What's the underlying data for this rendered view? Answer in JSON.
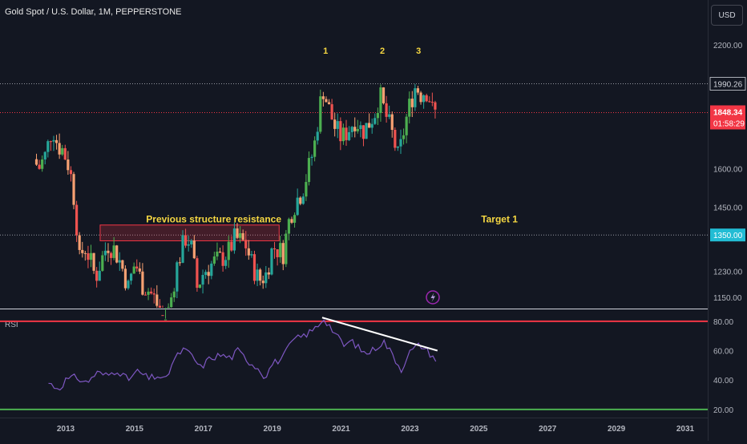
{
  "header": {
    "title": "Gold Spot / U.S. Dollar, 1M, PEPPERSTONE"
  },
  "price_scale": {
    "currency_button": "USD"
  },
  "colors": {
    "background": "#131722",
    "bull": "#26a69a",
    "bull_bright": "#4caf50",
    "bear": "#ef5350",
    "bear_soft": "#f7a072",
    "rsi_line": "#7e57c2",
    "overbought": "#f23645",
    "oversold": "#089981",
    "annotation": "#f5d742",
    "last_price_badge": "#f23645",
    "level_badge": "#22bcd4",
    "resistance_box": "#f2364555"
  },
  "chart_data": [
    {
      "type": "candlestick",
      "symbol": "Gold Spot / U.S. Dollar",
      "interval": "1M",
      "exchange": "PEPPERSTONE",
      "y_scale": "log",
      "ylim": [
        1120,
        2320
      ],
      "y_ticks": [
        2200.0,
        1600.0,
        1450.0,
        1230.0,
        1150.0
      ],
      "x_ticks": [
        "2013",
        "2015",
        "2017",
        "2019",
        "2021",
        "2023",
        "2025",
        "2027",
        "2029",
        "2031"
      ],
      "x_range_years": [
        2012.0,
        2032.0
      ],
      "last_price": {
        "value": "1848.34",
        "countdown": "01:58:29"
      },
      "level_labels": [
        {
          "value": "1990.26",
          "style": "plain"
        },
        {
          "value": "1350.00",
          "style": "badge"
        }
      ],
      "price_series_years": [
        2012.15,
        2023.75
      ],
      "price_anchors": [
        [
          2012.15,
          1640
        ],
        [
          2012.3,
          1600
        ],
        [
          2012.5,
          1660
        ],
        [
          2012.7,
          1780
        ],
        [
          2012.85,
          1700
        ],
        [
          2013.0,
          1680
        ],
        [
          2013.2,
          1600
        ],
        [
          2013.35,
          1460
        ],
        [
          2013.5,
          1240
        ],
        [
          2013.6,
          1320
        ],
        [
          2013.75,
          1280
        ],
        [
          2013.95,
          1210
        ],
        [
          2014.1,
          1260
        ],
        [
          2014.3,
          1320
        ],
        [
          2014.5,
          1300
        ],
        [
          2014.7,
          1250
        ],
        [
          2014.9,
          1180
        ],
        [
          2015.1,
          1260
        ],
        [
          2015.3,
          1190
        ],
        [
          2015.5,
          1170
        ],
        [
          2015.7,
          1140
        ],
        [
          2015.9,
          1070
        ],
        [
          2016.1,
          1120
        ],
        [
          2016.3,
          1240
        ],
        [
          2016.55,
          1340
        ],
        [
          2016.7,
          1330
        ],
        [
          2016.9,
          1180
        ],
        [
          2017.1,
          1230
        ],
        [
          2017.4,
          1260
        ],
        [
          2017.6,
          1270
        ],
        [
          2017.8,
          1290
        ],
        [
          2018.0,
          1340
        ],
        [
          2018.3,
          1320
        ],
        [
          2018.5,
          1250
        ],
        [
          2018.7,
          1200
        ],
        [
          2018.9,
          1220
        ],
        [
          2019.1,
          1310
        ],
        [
          2019.4,
          1290
        ],
        [
          2019.6,
          1420
        ],
        [
          2019.8,
          1480
        ],
        [
          2019.95,
          1510
        ],
        [
          2020.1,
          1580
        ],
        [
          2020.3,
          1690
        ],
        [
          2020.55,
          1970
        ],
        [
          2020.7,
          1880
        ],
        [
          2020.9,
          1780
        ],
        [
          2021.1,
          1730
        ],
        [
          2021.3,
          1770
        ],
        [
          2021.5,
          1820
        ],
        [
          2021.7,
          1760
        ],
        [
          2021.9,
          1800
        ],
        [
          2022.1,
          1860
        ],
        [
          2022.2,
          1940
        ],
        [
          2022.35,
          1850
        ],
        [
          2022.55,
          1760
        ],
        [
          2022.75,
          1640
        ],
        [
          2022.95,
          1800
        ],
        [
          2023.1,
          1900
        ],
        [
          2023.25,
          1980
        ],
        [
          2023.4,
          1940
        ],
        [
          2023.55,
          1960
        ],
        [
          2023.65,
          1920
        ],
        [
          2023.75,
          1848
        ]
      ],
      "annotations": [
        {
          "text": "1",
          "year": 2020.55,
          "price": 2150
        },
        {
          "text": "2",
          "year": 2022.2,
          "price": 2150
        },
        {
          "text": "3",
          "year": 2023.25,
          "price": 2150
        },
        {
          "text": "Previous structure resistance",
          "year": 2017.3,
          "price": 1395
        },
        {
          "text": "Target 1",
          "year": 2025.6,
          "price": 1395
        }
      ],
      "resistance_zone": {
        "years": [
          2014.0,
          2019.2
        ],
        "prices": [
          1330,
          1385
        ]
      }
    },
    {
      "type": "line",
      "name": "RSI",
      "ylim": [
        15,
        87
      ],
      "y_ticks": [
        80.0,
        60.0,
        40.0,
        20.0
      ],
      "overbought": 80,
      "oversold": 20,
      "series_years": [
        2012.5,
        2023.75
      ],
      "rsi_anchors": [
        [
          2012.5,
          38
        ],
        [
          2012.8,
          34
        ],
        [
          2013.0,
          40
        ],
        [
          2013.3,
          42
        ],
        [
          2013.6,
          38
        ],
        [
          2013.9,
          45
        ],
        [
          2014.2,
          43
        ],
        [
          2014.5,
          47
        ],
        [
          2014.8,
          40
        ],
        [
          2015.1,
          46
        ],
        [
          2015.4,
          41
        ],
        [
          2015.7,
          43
        ],
        [
          2015.9,
          39
        ],
        [
          2016.1,
          52
        ],
        [
          2016.4,
          61
        ],
        [
          2016.7,
          56
        ],
        [
          2016.9,
          48
        ],
        [
          2017.2,
          55
        ],
        [
          2017.5,
          57
        ],
        [
          2017.8,
          55
        ],
        [
          2018.0,
          60
        ],
        [
          2018.3,
          53
        ],
        [
          2018.6,
          48
        ],
        [
          2018.8,
          42
        ],
        [
          2019.0,
          51
        ],
        [
          2019.3,
          55
        ],
        [
          2019.6,
          67
        ],
        [
          2019.9,
          70
        ],
        [
          2020.2,
          74
        ],
        [
          2020.5,
          82
        ],
        [
          2020.7,
          76
        ],
        [
          2020.9,
          69
        ],
        [
          2021.1,
          63
        ],
        [
          2021.3,
          67
        ],
        [
          2021.5,
          62
        ],
        [
          2021.7,
          58
        ],
        [
          2021.9,
          60
        ],
        [
          2022.1,
          64
        ],
        [
          2022.25,
          66
        ],
        [
          2022.5,
          57
        ],
        [
          2022.75,
          47
        ],
        [
          2022.95,
          58
        ],
        [
          2023.15,
          62
        ],
        [
          2023.3,
          64
        ],
        [
          2023.5,
          60
        ],
        [
          2023.75,
          54
        ]
      ],
      "divergence_line": {
        "from": [
          2020.45,
          82.5
        ],
        "to": [
          2023.8,
          60
        ]
      }
    }
  ]
}
